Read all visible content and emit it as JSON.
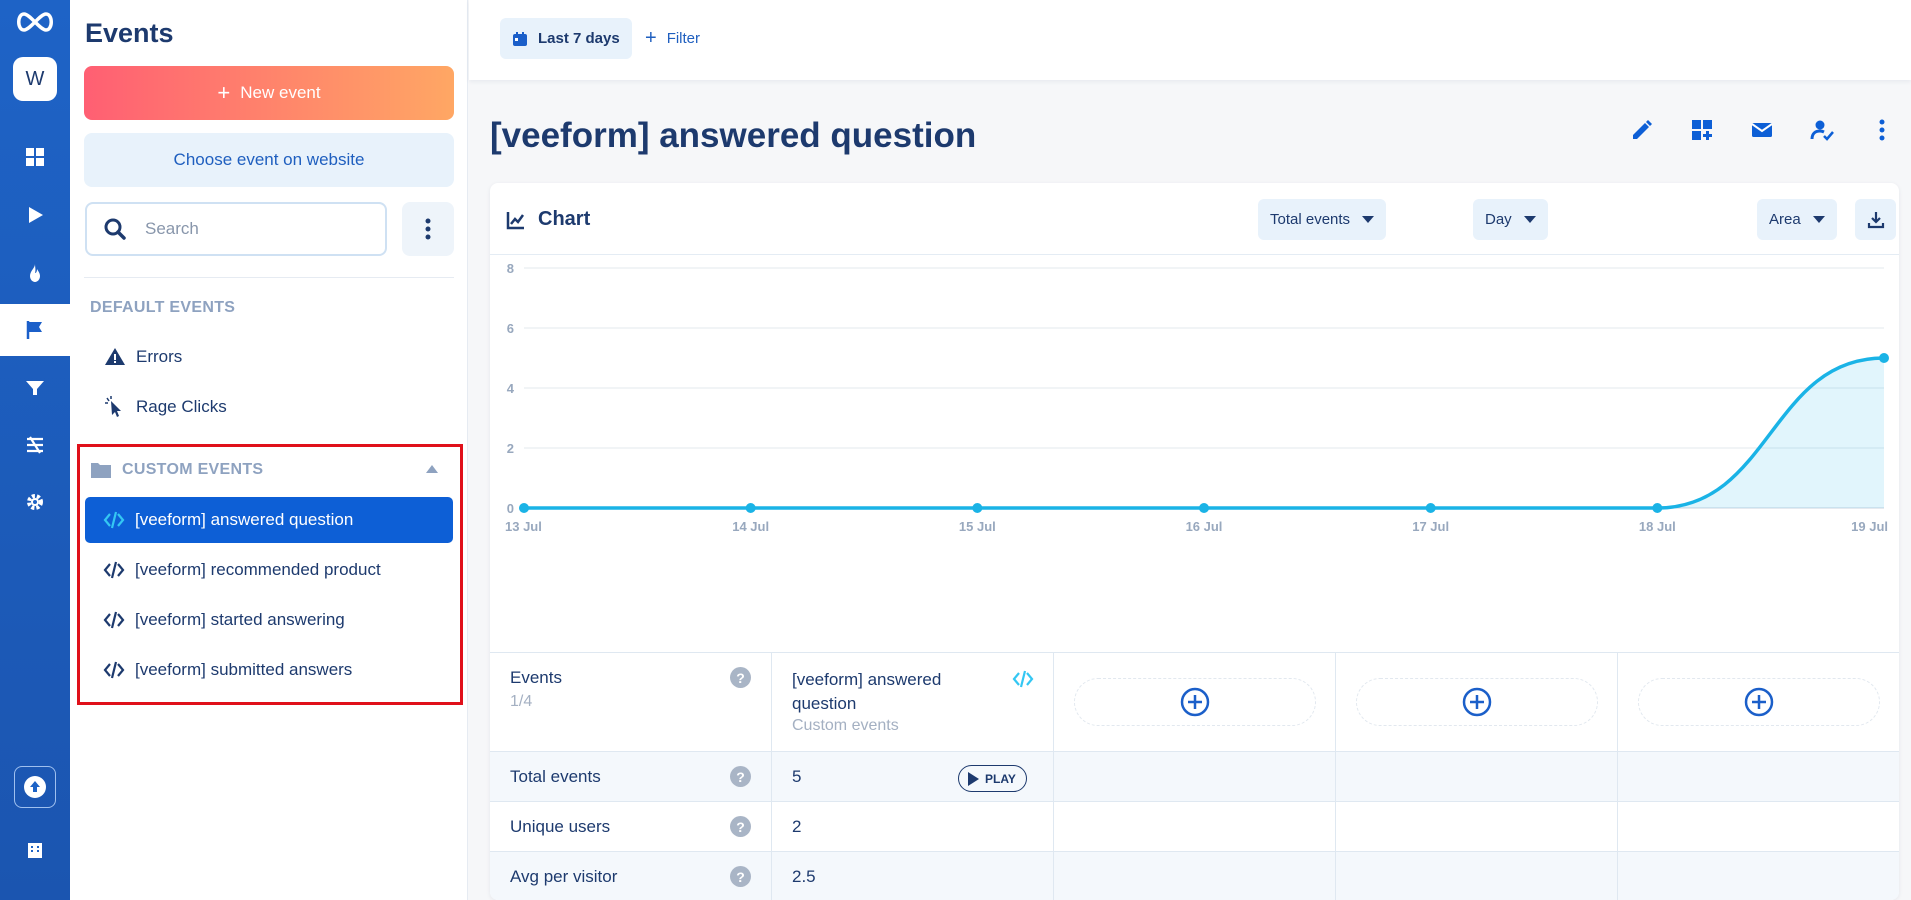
{
  "app": {
    "workspace_initial": "W",
    "accent": "#0d5fd6",
    "rail_color": "#1e63c6"
  },
  "rail": {
    "items": [
      {
        "name": "dashboard-icon",
        "active": false
      },
      {
        "name": "play-icon",
        "active": false
      },
      {
        "name": "flame-icon",
        "active": false
      },
      {
        "name": "flag-icon",
        "active": true
      },
      {
        "name": "funnel-icon",
        "active": false
      },
      {
        "name": "journey-icon",
        "active": false
      },
      {
        "name": "gear-icon",
        "active": false
      }
    ],
    "bottom": [
      "upgrade-icon",
      "building-icon"
    ]
  },
  "sidebar": {
    "title": "Events",
    "new_event_label": "New event",
    "choose_event_label": "Choose event on website",
    "search_placeholder": "Search",
    "default_section": "DEFAULT EVENTS",
    "default_items": [
      {
        "label": "Errors",
        "icon": "warning-icon"
      },
      {
        "label": "Rage Clicks",
        "icon": "rage-click-icon"
      }
    ],
    "custom_section": "CUSTOM EVENTS",
    "custom_items": [
      {
        "label": "[veeform] answered question",
        "selected": true
      },
      {
        "label": "[veeform] recommended product",
        "selected": false
      },
      {
        "label": "[veeform] started answering",
        "selected": false
      },
      {
        "label": "[veeform] submitted answers",
        "selected": false
      }
    ]
  },
  "topbar": {
    "date_range": "Last 7 days",
    "filter_label": "Filter"
  },
  "page": {
    "title": "[veeform] answered question",
    "actions": [
      "edit-icon",
      "add-to-dashboard-icon",
      "email-icon",
      "assign-icon",
      "more-icon"
    ]
  },
  "chart_card": {
    "title": "Chart",
    "metric_select": "Total events",
    "interval_select": "Day",
    "chart_type_select": "Area"
  },
  "chart_data": {
    "type": "area",
    "title": "",
    "xlabel": "",
    "ylabel": "",
    "categories": [
      "13 Jul",
      "14 Jul",
      "15 Jul",
      "16 Jul",
      "17 Jul",
      "18 Jul",
      "19 Jul"
    ],
    "series": [
      {
        "values": [
          0,
          0,
          0,
          0,
          0,
          0,
          5
        ]
      }
    ],
    "y_ticks": [
      0,
      2,
      4,
      6,
      8
    ],
    "ylim": [
      0,
      8
    ],
    "grid": true,
    "color": "#1ab3e6"
  },
  "table": {
    "header": {
      "events_label": "Events",
      "events_count": "1/4",
      "event_name": "[veeform] answered question",
      "event_type": "Custom events"
    },
    "rows": [
      {
        "label": "Total events",
        "value": "5",
        "play_label": "PLAY"
      },
      {
        "label": "Unique users",
        "value": "2"
      },
      {
        "label": "Avg per visitor",
        "value": "2.5"
      }
    ],
    "help_glyph": "?"
  }
}
